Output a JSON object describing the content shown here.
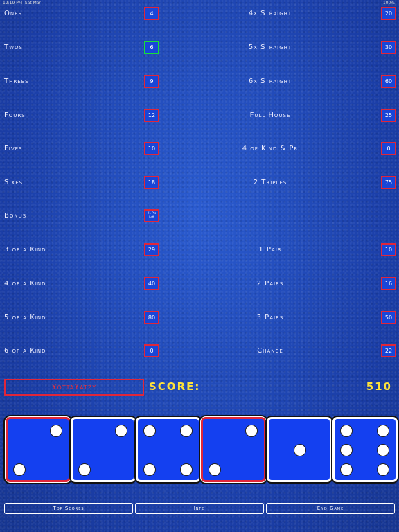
{
  "status": {
    "time": "12:19 PM",
    "day": "Sat Mar",
    "battery": "100%"
  },
  "left": [
    {
      "label": "Ones",
      "value": "4"
    },
    {
      "label": "Twos",
      "value": "6",
      "selected": true
    },
    {
      "label": "Threes",
      "value": "9"
    },
    {
      "label": "Fours",
      "value": "12"
    },
    {
      "label": "Fives",
      "value": "10"
    },
    {
      "label": "Sixes",
      "value": "18"
    },
    {
      "label": "Bonus",
      "value": "21 Pts Left"
    },
    {
      "label": "3 of a Kind",
      "value": "29"
    },
    {
      "label": "4 of a Kind",
      "value": "40"
    },
    {
      "label": "5 of a Kind",
      "value": "80"
    },
    {
      "label": "6 of a Kind",
      "value": "0"
    }
  ],
  "right": [
    {
      "label": "4x Straight",
      "value": "20"
    },
    {
      "label": "5x Straight",
      "value": "30"
    },
    {
      "label": "6x Straight",
      "value": "60"
    },
    {
      "label": "Full House",
      "value": "25"
    },
    {
      "label": "4 of Kind & Pr",
      "value": "0"
    },
    {
      "label": "2 Triples",
      "value": "75"
    },
    {
      "label": "",
      "value": ""
    },
    {
      "label": "1 Pair",
      "value": "10"
    },
    {
      "label": "2 Pairs",
      "value": "16"
    },
    {
      "label": "3 Pairs",
      "value": "50"
    },
    {
      "label": "Chance",
      "value": "22"
    }
  ],
  "yotta_label": "YottaYatzy",
  "score_label": "SCORE:",
  "score_value": "510",
  "dice": [
    {
      "value": 2,
      "held": true
    },
    {
      "value": 2,
      "held": false
    },
    {
      "value": 4,
      "held": false
    },
    {
      "value": 2,
      "held": true
    },
    {
      "value": 1,
      "held": false
    },
    {
      "value": 6,
      "held": false
    }
  ],
  "buttons": {
    "top_scores": "Top Scores",
    "info": "Info",
    "end_game": "End Game"
  },
  "colors": {
    "accent_red": "#e0263a",
    "selected_green": "#18e038",
    "score_yellow": "#ffe23a",
    "die_blue": "#1440f0"
  }
}
